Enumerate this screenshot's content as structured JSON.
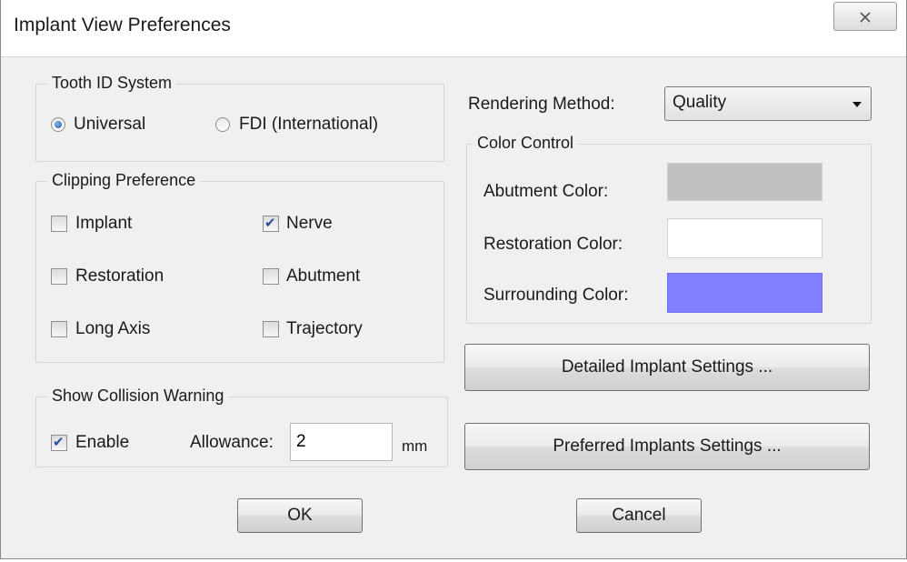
{
  "window": {
    "title": "Implant View Preferences",
    "close_icon": "close-x-icon"
  },
  "tooth_id": {
    "title": "Tooth ID System",
    "options": [
      {
        "label": "Universal",
        "selected": true
      },
      {
        "label": "FDI (International)",
        "selected": false
      }
    ]
  },
  "clipping": {
    "title": "Clipping Preference",
    "items": [
      {
        "label": "Implant",
        "checked": false
      },
      {
        "label": "Nerve",
        "checked": true
      },
      {
        "label": "Restoration",
        "checked": false
      },
      {
        "label": "Abutment",
        "checked": false
      },
      {
        "label": "Long Axis",
        "checked": false
      },
      {
        "label": "Trajectory",
        "checked": false
      }
    ]
  },
  "collision": {
    "title": "Show Collision Warning",
    "enable_label": "Enable",
    "enabled": true,
    "allowance_label": "Allowance:",
    "allowance_value": "2",
    "unit": "mm"
  },
  "rendering": {
    "label": "Rendering Method:",
    "value": "Quality"
  },
  "color_control": {
    "title": "Color Control",
    "items": [
      {
        "label": "Abutment Color:",
        "color": "#c0c0c0"
      },
      {
        "label": "Restoration Color:",
        "color": "#ffffff"
      },
      {
        "label": "Surrounding Color:",
        "color": "#8080ff"
      }
    ]
  },
  "buttons": {
    "detailed": "Detailed Implant Settings ...",
    "preferred": "Preferred Implants Settings ...",
    "ok": "OK",
    "cancel": "Cancel"
  }
}
